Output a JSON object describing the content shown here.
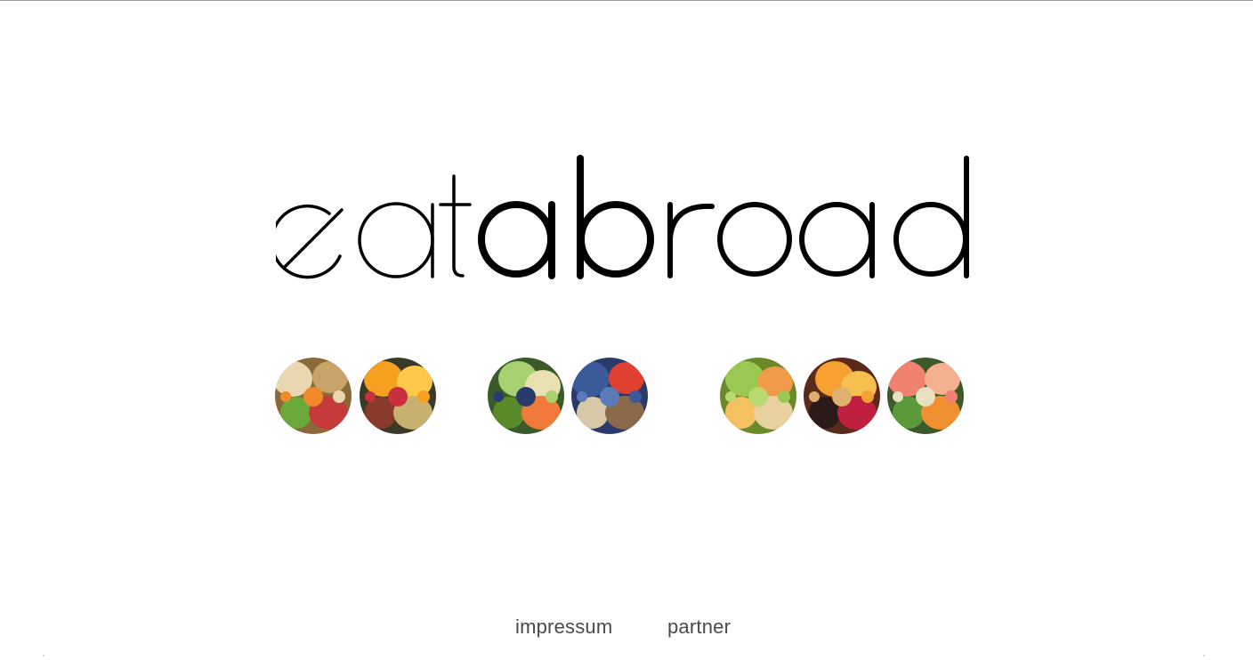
{
  "brand": {
    "name": "eatabroad"
  },
  "food_circles": [
    {
      "name": "food-circle-1",
      "colors": {
        "bg": "#8a6a3a",
        "a": "#e8d7b0",
        "b": "#c8a46a",
        "c": "#6aa83a",
        "d": "#c53a3a",
        "e": "#f08a2a"
      }
    },
    {
      "name": "food-circle-2",
      "colors": {
        "bg": "#3a3a2a",
        "a": "#f5a020",
        "b": "#ffc848",
        "c": "#8a3a2a",
        "d": "#c8b070",
        "e": "#c83040"
      }
    },
    {
      "name": "food-circle-3",
      "colors": {
        "bg": "#3a5a2a",
        "a": "#a8d070",
        "b": "#e8e0b0",
        "c": "#5a8a2a",
        "d": "#f07a3a",
        "e": "#2a3a6a"
      }
    },
    {
      "name": "food-circle-4",
      "colors": {
        "bg": "#2a3a6a",
        "a": "#3a5a9a",
        "b": "#e04030",
        "c": "#d8c8a8",
        "d": "#8a6a4a",
        "e": "#5a7ab8"
      }
    },
    {
      "name": "food-circle-5",
      "colors": {
        "bg": "#6a8a2a",
        "a": "#9ac850",
        "b": "#f09a4a",
        "c": "#f5c060",
        "d": "#e8d0a0",
        "e": "#b8d870"
      }
    },
    {
      "name": "food-circle-6",
      "colors": {
        "bg": "#5a2a1a",
        "a": "#f5a030",
        "b": "#f5c050",
        "c": "#2a1a1a",
        "d": "#c02040",
        "e": "#e0b070"
      }
    },
    {
      "name": "food-circle-7",
      "colors": {
        "bg": "#3a5a2a",
        "a": "#f08070",
        "b": "#f5b090",
        "c": "#5a9a3a",
        "d": "#f09030",
        "e": "#e8e0c0"
      }
    }
  ],
  "footer": {
    "links": [
      {
        "label": "impressum"
      },
      {
        "label": "partner"
      }
    ]
  },
  "colors": {
    "background": "#ffffff",
    "logo": "#000000",
    "footer_text": "#4a4a4a"
  }
}
